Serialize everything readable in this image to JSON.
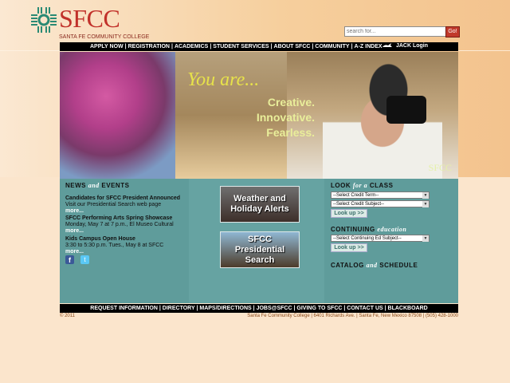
{
  "header": {
    "logo_text": "SFCC",
    "logo_subtitle": "SANTA FE COMMUNITY COLLEGE",
    "search": {
      "placeholder": "search for...",
      "go_label": "Go!"
    }
  },
  "nav": {
    "items": [
      "APPLY NOW",
      "REGISTRATION",
      "ACADEMICS",
      "STUDENT SERVICES",
      "ABOUT SFCC",
      "COMMUNITY",
      "A-Z INDEX"
    ],
    "jack_login": "JACK Login"
  },
  "hero": {
    "headline": "You are...",
    "tagline": [
      "Creative.",
      "Innovative.",
      "Fearless."
    ],
    "mark": "SFCC"
  },
  "news": {
    "heading": "NEWS",
    "heading_and": "and",
    "heading_tail": "EVENTS",
    "items": [
      {
        "title": "Candidates for SFCC President Announced",
        "desc": "Visit our Presidential Search web page",
        "more": "more..."
      },
      {
        "title": "SFCC Performing Arts Spring Showcase",
        "desc": "Monday, May 7 at 7 p.m., El Museo Cultural",
        "more": "more..."
      },
      {
        "title": "Kids Campus Open House",
        "desc": "3:30 to 5:30 p.m. Tues., May 8 at SFCC",
        "more": "more..."
      }
    ]
  },
  "promos": {
    "weather": [
      "Weather and",
      "Holiday Alerts"
    ],
    "search": [
      "SFCC",
      "Presidential",
      "Search"
    ]
  },
  "lookup": {
    "heading": "LOOK",
    "heading_for": "for a",
    "heading_tail": "CLASS",
    "term_select": "--Select Credit Term--",
    "subject_select": "--Select Credit Subject--",
    "button": "Look up >>",
    "continuing_heading": "CONTINUING",
    "continuing_italic": "Education",
    "continuing_select": "--Select Continuing Ed Subject--",
    "continuing_button": "Look up >>",
    "catalog_heading": "CATALOG",
    "catalog_and": "and",
    "catalog_tail": "SCHEDULE"
  },
  "footer": {
    "links": [
      "REQUEST INFORMATION",
      "DIRECTORY",
      "MAPS/DIRECTIONS",
      "JOBS@SFCC",
      "GIVING TO SFCC",
      "CONTACT US",
      "BLACKBOARD"
    ],
    "copyright": "© 2011",
    "address": "Santa Fe Community College | 6401 Richards Ave. | Santa Fe, New Mexico 87508 | (505) 428-1000"
  }
}
